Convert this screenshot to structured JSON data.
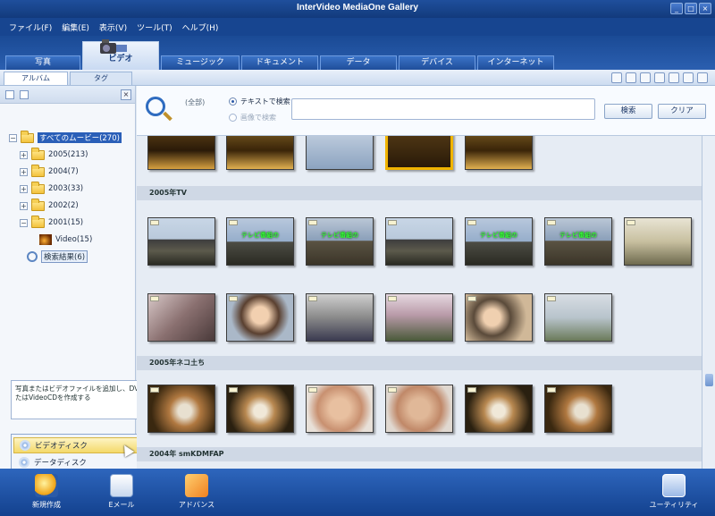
{
  "window": {
    "title": "InterVideo MediaOne Gallery",
    "controls": [
      "_",
      "□",
      "×"
    ]
  },
  "menu": [
    "ファイル(F)",
    "編集(E)",
    "表示(V)",
    "ツール(T)",
    "ヘルプ(H)"
  ],
  "tabs": [
    {
      "label": "写真",
      "active": false
    },
    {
      "label": "ビデオ",
      "active": true
    },
    {
      "label": "ミュージック",
      "active": false
    },
    {
      "label": "ドキュメント",
      "active": false
    },
    {
      "label": "データ",
      "active": false
    },
    {
      "label": "デバイス",
      "active": false
    },
    {
      "label": "インターネット",
      "active": false
    }
  ],
  "subtabs": [
    {
      "label": "アルバム",
      "active": true
    },
    {
      "label": "タグ",
      "active": false
    }
  ],
  "tree": {
    "root": "すべてのムービー(270)",
    "folders": [
      "2005(213)",
      "2004(7)",
      "2003(33)",
      "2002(2)",
      "2001(15)"
    ],
    "video_item": "Video(15)",
    "search_results": "検索結果(6)"
  },
  "search": {
    "label": "(全部)",
    "option_text": "テキストで検索",
    "option_similar": "画像で検索",
    "query": "",
    "search_button": "検索",
    "clear_button": "クリア"
  },
  "sections": [
    "2005年TV",
    "2005年ネコ土ち",
    "2004年 smKDMFAP"
  ],
  "thumb_captions": [
    "テレビ番組の",
    "テレビ番組の",
    "テレビ番組の",
    "テレビ番組の"
  ],
  "hint": "写真またはビデオファイルを追加し、DVDまたはVideoCDを作成する",
  "popup": {
    "items": [
      "ビデオディスク",
      "データディスク"
    ]
  },
  "bottom": {
    "new": "新規作成",
    "email": "Eメール",
    "advanced": "アドバンス",
    "utility": "ユーティリティ"
  },
  "colors": {
    "accent": "#1f4f9c",
    "selection": "#2a5fb8",
    "highlight": "#f4d96a"
  }
}
